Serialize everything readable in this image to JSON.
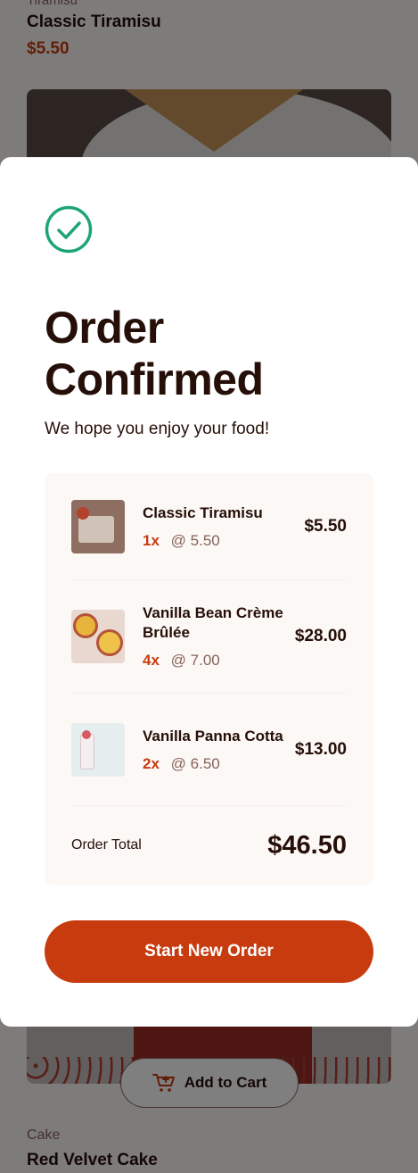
{
  "background": {
    "top_item": {
      "category": "Tiramisu",
      "name": "Classic Tiramisu",
      "price": "$5.50"
    },
    "add_to_cart_label": "Add to Cart",
    "bottom_item": {
      "category": "Cake",
      "name": "Red Velvet Cake"
    }
  },
  "modal": {
    "title": "Order Confirmed",
    "subtitle": "We hope you enjoy your food!",
    "items": [
      {
        "name": "Classic Tiramisu",
        "qty": "1x",
        "unit_price": "@ 5.50",
        "line_total": "$5.50"
      },
      {
        "name": "Vanilla Bean Crème Brûlée",
        "qty": "4x",
        "unit_price": "@ 7.00",
        "line_total": "$28.00"
      },
      {
        "name": "Vanilla Panna Cotta",
        "qty": "2x",
        "unit_price": "@ 6.50",
        "line_total": "$13.00"
      }
    ],
    "total_label": "Order Total",
    "total_value": "$46.50",
    "start_button_label": "Start New Order"
  },
  "colors": {
    "accent": "#c73b0f",
    "success": "#1ea575",
    "text_dark": "#260f08",
    "text_muted": "#87635a",
    "panel_bg": "#fcf8f6"
  }
}
